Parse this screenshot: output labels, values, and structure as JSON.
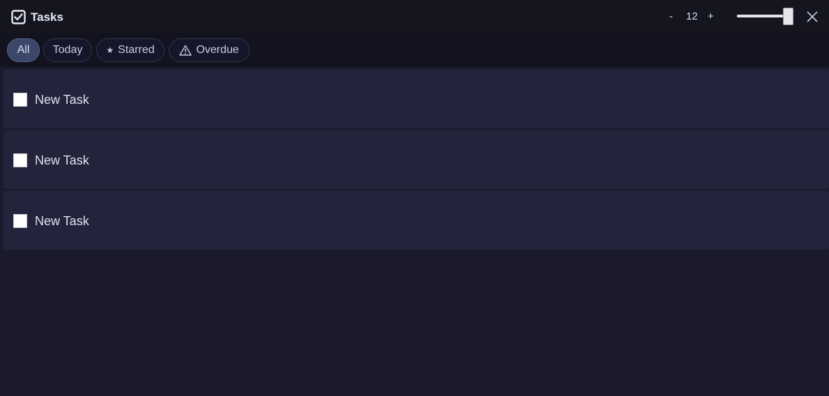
{
  "window": {
    "title": "Tasks",
    "app_icon": "checkbox-icon",
    "font_minus": "-",
    "font_size": "12",
    "font_plus": "+",
    "opacity_slider_value": 1.0,
    "close_icon": "close-icon"
  },
  "filters": [
    {
      "label": "All",
      "icon": null,
      "active": true
    },
    {
      "label": "Today",
      "icon": null,
      "active": false
    },
    {
      "label": "Starred",
      "icon": "star-icon",
      "active": false
    },
    {
      "label": "Overdue",
      "icon": "warning-icon",
      "active": false
    }
  ],
  "tasks": [
    {
      "label": "New Task",
      "checked": false
    },
    {
      "label": "New Task",
      "checked": false
    },
    {
      "label": "New Task",
      "checked": false
    }
  ],
  "colors": {
    "background": "#1b1b2d",
    "titlebar": "#15151f",
    "row": "#23243b",
    "active_chip": "#3b4769"
  }
}
